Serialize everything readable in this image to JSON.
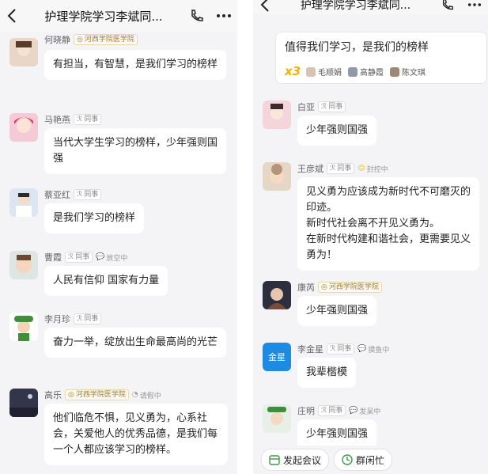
{
  "left": {
    "title": "护理学院学习李斌同...",
    "messages": [
      {
        "name": "何晓静",
        "org": "河西学院医学院",
        "status": "",
        "text": "有担当，有智慧，是我们学习的榜样"
      },
      {
        "name": "马艳燕",
        "tag": "同事",
        "status": "",
        "text": "当代大学生学习的榜样，少年强则国强"
      },
      {
        "name": "蔡亚红",
        "tag": "同事",
        "status": "",
        "text": "是我们学习的榜样"
      },
      {
        "name": "曹霞",
        "tag": "同事",
        "status": "放空中",
        "text": "人民有信仰 国家有力量"
      },
      {
        "name": "李月珍",
        "tag": "同事",
        "status": "",
        "text": "奋力一举，绽放出生命最高尚的光芒"
      },
      {
        "name": "高乐",
        "org": "河西学院医学院",
        "status": "请假中",
        "text": "他们临危不惧，见义勇为，心系社会，关爱他人的优秀品德，是我们每一个人都应该学习的榜样。"
      }
    ]
  },
  "right": {
    "title": "护理学院学习李斌同...",
    "pinned": {
      "text": "值得我们学习，是我们的榜样",
      "count": "x3",
      "users": [
        "毛顺娟",
        "高静霞",
        "陈文琪"
      ]
    },
    "messages": [
      {
        "name": "白亚",
        "tag": "同事",
        "status": "",
        "text": "少年强则国强"
      },
      {
        "name": "王彦斌",
        "tag": "同事",
        "status": "封控中",
        "text": "见义勇为应该成为新时代不可磨灭的印迹。\n新时代社会离不开见义勇为。\n在新时代构建和谐社会，更需要见义勇为！"
      },
      {
        "name": "康芮",
        "org": "河西学院医学院",
        "status": "",
        "text": "少年强则国强"
      },
      {
        "name": "李金星",
        "tag": "同事",
        "status": "摸鱼中",
        "avatar_text": "金星",
        "text": "我辈楷模"
      },
      {
        "name": "庄明",
        "tag": "同事",
        "status": "发呆中",
        "text": "少年强则国强"
      }
    ],
    "bottom_buttons": [
      "发起会议",
      "群闲忙"
    ]
  },
  "colors": {
    "accent": "#f0b400",
    "green": "#3c9a4a",
    "bubble": "#ffffff",
    "bg": "#f4f4f6"
  }
}
